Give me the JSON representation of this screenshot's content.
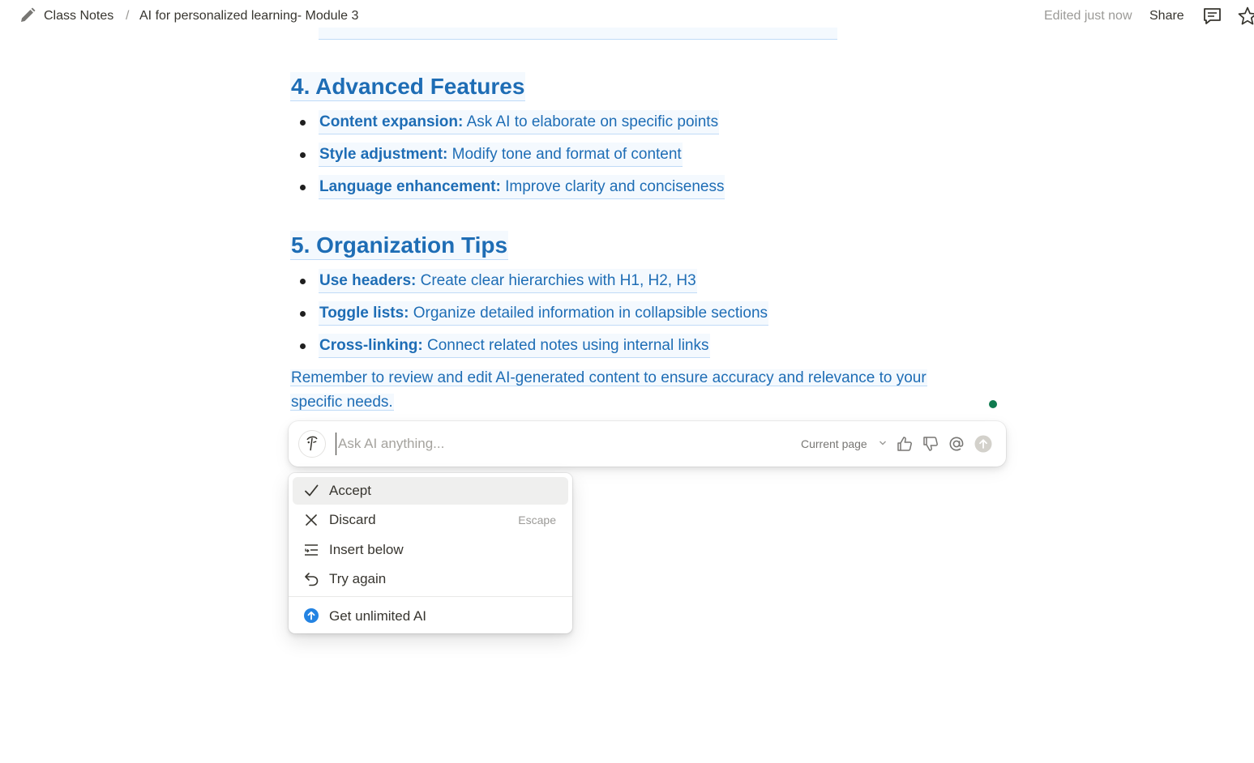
{
  "header": {
    "breadcrumb": [
      "Class Notes",
      "AI for personalized learning- Module 3"
    ],
    "separator": "/",
    "edited": "Edited just now",
    "share_label": "Share",
    "icons": [
      "edit-pencil-icon",
      "comment-icon",
      "star-icon"
    ]
  },
  "content": {
    "section4": {
      "heading": "4. Advanced Features",
      "items": [
        {
          "term": "Content expansion:",
          "text": " Ask AI to elaborate on specific points"
        },
        {
          "term": "Style adjustment:",
          "text": " Modify tone and format of content"
        },
        {
          "term": "Language enhancement:",
          "text": " Improve clarity and conciseness"
        }
      ]
    },
    "section5": {
      "heading": "5. Organization Tips",
      "items": [
        {
          "term": "Use headers:",
          "text": " Create clear hierarchies with H1, H2, H3"
        },
        {
          "term": "Toggle lists:",
          "text": " Organize detailed information in collapsible sections"
        },
        {
          "term": "Cross-linking:",
          "text": " Connect related notes using internal links"
        }
      ]
    },
    "closing": {
      "line1": "Remember to review and edit AI-generated content to ensure accuracy and relevance to your",
      "line2": "specific needs."
    }
  },
  "ai_prompt": {
    "placeholder": "Ask AI anything...",
    "scope_label": "Current page",
    "icons": [
      "ai-face-icon",
      "chevron-down-icon",
      "thumbs-up-icon",
      "thumbs-down-icon",
      "mention-icon",
      "send-icon"
    ]
  },
  "ai_menu": {
    "items": [
      {
        "label": "Accept",
        "icon": "check-icon"
      },
      {
        "label": "Discard",
        "shortcut": "Escape",
        "icon": "close-icon"
      },
      {
        "label": "Insert below",
        "icon": "insert-below-icon"
      },
      {
        "label": "Try again",
        "icon": "undo-icon"
      }
    ],
    "upgrade": {
      "label": "Get unlimited AI",
      "icon": "upgrade-arrow-icon"
    }
  },
  "colors": {
    "ai_text": "#1e6db5",
    "status_dot": "#0f7b4f",
    "upgrade_icon": "#2383e2"
  }
}
